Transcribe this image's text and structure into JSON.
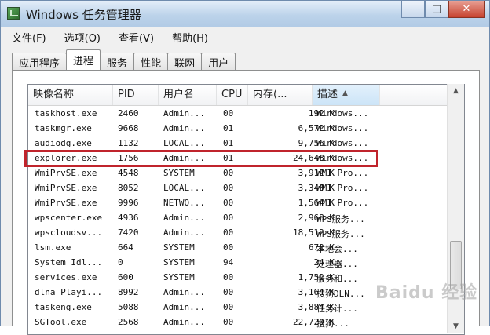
{
  "window": {
    "title": "Windows 任务管理器",
    "buttons": {
      "minimize": "—",
      "maximize": "□",
      "close": "✕"
    }
  },
  "menu": [
    "文件(F)",
    "选项(O)",
    "查看(V)",
    "帮助(H)"
  ],
  "tabs": [
    {
      "label": "应用程序",
      "active": false
    },
    {
      "label": "进程",
      "active": true
    },
    {
      "label": "服务",
      "active": false
    },
    {
      "label": "性能",
      "active": false
    },
    {
      "label": "联网",
      "active": false
    },
    {
      "label": "用户",
      "active": false
    }
  ],
  "columns": {
    "name": "映像名称",
    "pid": "PID",
    "user": "用户名",
    "cpu": "CPU",
    "mem": "内存(...",
    "desc": "描述"
  },
  "processes": [
    {
      "name": "taskhost.exe",
      "pid": "2460",
      "user": "Admin...",
      "cpu": "00",
      "mem": "192 K",
      "desc": "Windows..."
    },
    {
      "name": "taskmgr.exe",
      "pid": "9668",
      "user": "Admin...",
      "cpu": "01",
      "mem": "6,572 K",
      "desc": "Windows..."
    },
    {
      "name": "audiodg.exe",
      "pid": "1132",
      "user": "LOCAL...",
      "cpu": "01",
      "mem": "9,756 K",
      "desc": "Windows..."
    },
    {
      "name": "explorer.exe",
      "pid": "1756",
      "user": "Admin...",
      "cpu": "01",
      "mem": "24,648 K",
      "desc": "Windows..."
    },
    {
      "name": "WmiPrvSE.exe",
      "pid": "4548",
      "user": "SYSTEM",
      "cpu": "00",
      "mem": "3,912 K",
      "desc": "WMI Pro..."
    },
    {
      "name": "WmiPrvSE.exe",
      "pid": "8052",
      "user": "LOCAL...",
      "cpu": "00",
      "mem": "3,340 K",
      "desc": "WMI Pro..."
    },
    {
      "name": "WmiPrvSE.exe",
      "pid": "9996",
      "user": "NETWO...",
      "cpu": "00",
      "mem": "1,564 K",
      "desc": "WMI Pro..."
    },
    {
      "name": "wpscenter.exe",
      "pid": "4936",
      "user": "Admin...",
      "cpu": "00",
      "mem": "2,968 K",
      "desc": "WPS服务..."
    },
    {
      "name": "wpscloudsv...",
      "pid": "7420",
      "user": "Admin...",
      "cpu": "00",
      "mem": "18,512 K",
      "desc": "WPS服务..."
    },
    {
      "name": "lsm.exe",
      "pid": "664",
      "user": "SYSTEM",
      "cpu": "00",
      "mem": "672 K",
      "desc": "本地会..."
    },
    {
      "name": "System Idl...",
      "pid": "0",
      "user": "SYSTEM",
      "cpu": "94",
      "mem": "24 K",
      "desc": "处理器..."
    },
    {
      "name": "services.exe",
      "pid": "600",
      "user": "SYSTEM",
      "cpu": "00",
      "mem": "1,752 K",
      "desc": "服务和..."
    },
    {
      "name": "dlna_Playi...",
      "pid": "8992",
      "user": "Admin...",
      "cpu": "00",
      "mem": "3,164 K",
      "desc": "搜狗DLN..."
    },
    {
      "name": "taskeng.exe",
      "pid": "5088",
      "user": "Admin...",
      "cpu": "00",
      "mem": "3,884 K",
      "desc": "任务计..."
    },
    {
      "name": "SGTool.exe",
      "pid": "2568",
      "user": "Admin...",
      "cpu": "00",
      "mem": "22,720 K",
      "desc": "搜狗..."
    }
  ],
  "selected_process": "explorer.exe",
  "watermark": "Baidu 经验"
}
